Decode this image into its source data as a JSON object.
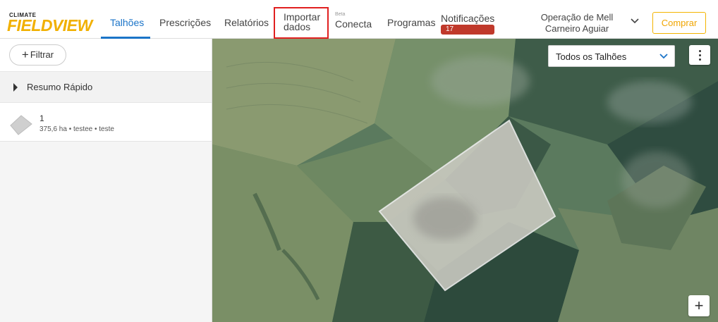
{
  "brand": {
    "small": "CLIMATE",
    "big": "FIELDVIEW"
  },
  "nav": {
    "talhoes": "Talhões",
    "prescricoes": "Prescrições",
    "relatorios": "Relatórios",
    "importar_line1": "Importar",
    "importar_line2": "dados",
    "conecta_beta": "Beta",
    "conecta": "Conecta",
    "programas": "Programas",
    "notificacoes": "Notificações",
    "notificacoes_count": "17"
  },
  "account": {
    "line1": "Operação de Mell",
    "line2": "Carneiro Aguiar"
  },
  "buy_label": "Comprar",
  "sidebar": {
    "filter_label": "Filtrar",
    "resumo_label": "Resumo Rápido",
    "fields": [
      {
        "name": "1",
        "meta": "375,6 ha • testee • teste"
      }
    ]
  },
  "map": {
    "selector_value": "Todos os Talhões",
    "zoom_in_label": "+"
  },
  "colors": {
    "accent": "#1b74c8",
    "brand": "#f1b000",
    "badge": "#c0392b",
    "highlight": "#e02020"
  }
}
